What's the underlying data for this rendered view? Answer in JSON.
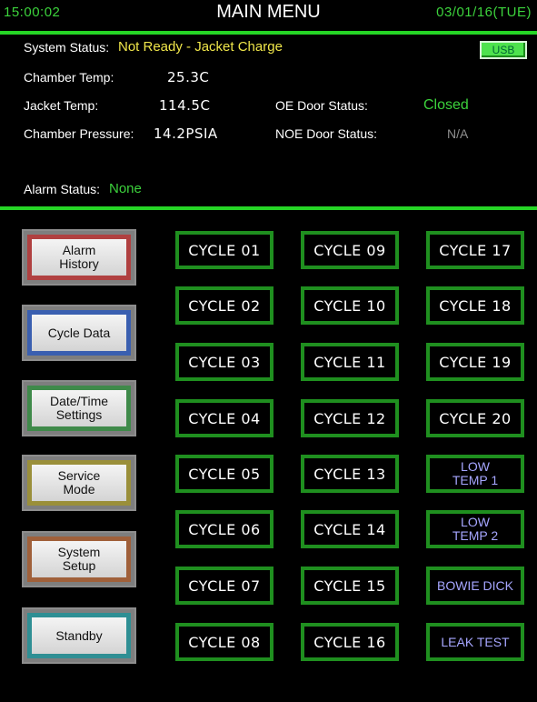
{
  "header": {
    "time": "15:00:02",
    "title": "MAIN MENU",
    "date": "03/01/16(TUE)"
  },
  "status": {
    "system_label": "System Status:",
    "system_value": "Not Ready - Jacket Charge",
    "usb_label": "USB",
    "chamber_temp_label": "Chamber Temp:",
    "chamber_temp_value": "25.3C",
    "jacket_temp_label": "Jacket Temp:",
    "jacket_temp_value": "114.5C",
    "chamber_pressure_label": "Chamber Pressure:",
    "chamber_pressure_value": "14.2PSIA",
    "oe_door_label": "OE Door Status:",
    "oe_door_value": "Closed",
    "noe_door_label": "NOE Door Status:",
    "noe_door_value": "N/A",
    "alarm_label": "Alarm Status:",
    "alarm_value": "None"
  },
  "sidebar": [
    {
      "label": "Alarm\nHistory",
      "color": "#b04040"
    },
    {
      "label": "Cycle Data",
      "color": "#3a5fb0"
    },
    {
      "label": "Date/Time\nSettings",
      "color": "#3f8a4a"
    },
    {
      "label": "Service\nMode",
      "color": "#9a8f3a"
    },
    {
      "label": "System\nSetup",
      "color": "#a0603a"
    },
    {
      "label": "Standby",
      "color": "#2f8f94"
    }
  ],
  "cycles": {
    "col1": [
      "CYCLE 01",
      "CYCLE 02",
      "CYCLE 03",
      "CYCLE 04",
      "CYCLE 05",
      "CYCLE 06",
      "CYCLE 07",
      "CYCLE 08"
    ],
    "col2": [
      "CYCLE 09",
      "CYCLE 10",
      "CYCLE 11",
      "CYCLE 12",
      "CYCLE 13",
      "CYCLE 14",
      "CYCLE 15",
      "CYCLE 16"
    ],
    "col3": [
      "CYCLE 17",
      "CYCLE 18",
      "CYCLE 19",
      "CYCLE 20",
      "LOW\nTEMP 1",
      "LOW\nTEMP 2",
      "BOWIE DICK",
      "LEAK TEST"
    ]
  },
  "colors": {
    "accent_green": "#26d626",
    "cycle_border": "#1f8f1f",
    "status_yellow": "#f0e64a",
    "special_text": "#a6a6ff"
  }
}
